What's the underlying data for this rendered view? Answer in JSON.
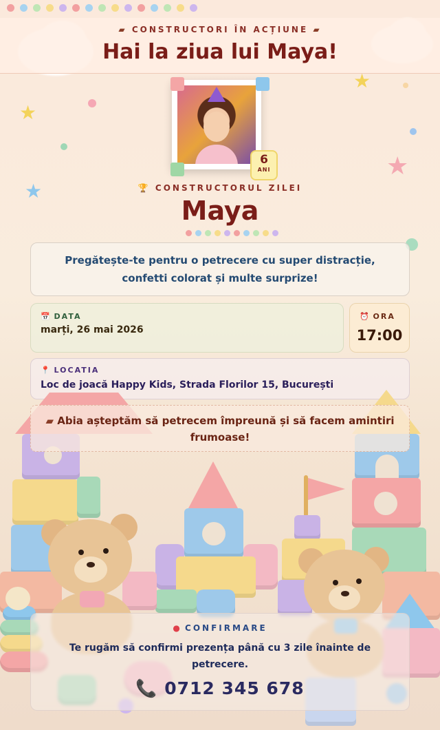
{
  "header": {
    "eyebrow": "CONSTRUCTORI ÎN ACȚIUNE",
    "title": "Hai la ziua lui Maya!"
  },
  "celebrant": {
    "age": "6",
    "age_unit": "ANI",
    "builder_label": "CONSTRUCTORUL ZILEI",
    "name": "Maya"
  },
  "intro": {
    "text": "Pregătește-te pentru o petrecere cu super distracție, confetti colorat și multe surprize!"
  },
  "date": {
    "label": "DATA",
    "value": "marți, 26 mai 2026"
  },
  "time": {
    "label": "ORA",
    "value": "17:00"
  },
  "location": {
    "label": "LOCATIA",
    "value": "Loc de joacă Happy Kids, Strada Florilor 15, București"
  },
  "message": {
    "text": "Abia așteptăm să petrecem împreună și să facem amintiri frumoase!"
  },
  "confirm": {
    "label": "CONFIRMARE",
    "text": "Te rugăm să confirmi prezența până cu 3 zile înainte de petrecere.",
    "phone": "0712 345 678"
  },
  "icons": {
    "brick": "brick-icon",
    "trophy": "trophy-icon",
    "calendar": "calendar-icon",
    "clock": "alarm-clock-icon",
    "pin": "map-pin-icon",
    "phone": "phone-icon"
  },
  "colors": {
    "title": "#7a1d18",
    "accent_blue": "#244a72",
    "date_green": "#2f5f3c",
    "location_purple": "#4a2f7a"
  }
}
